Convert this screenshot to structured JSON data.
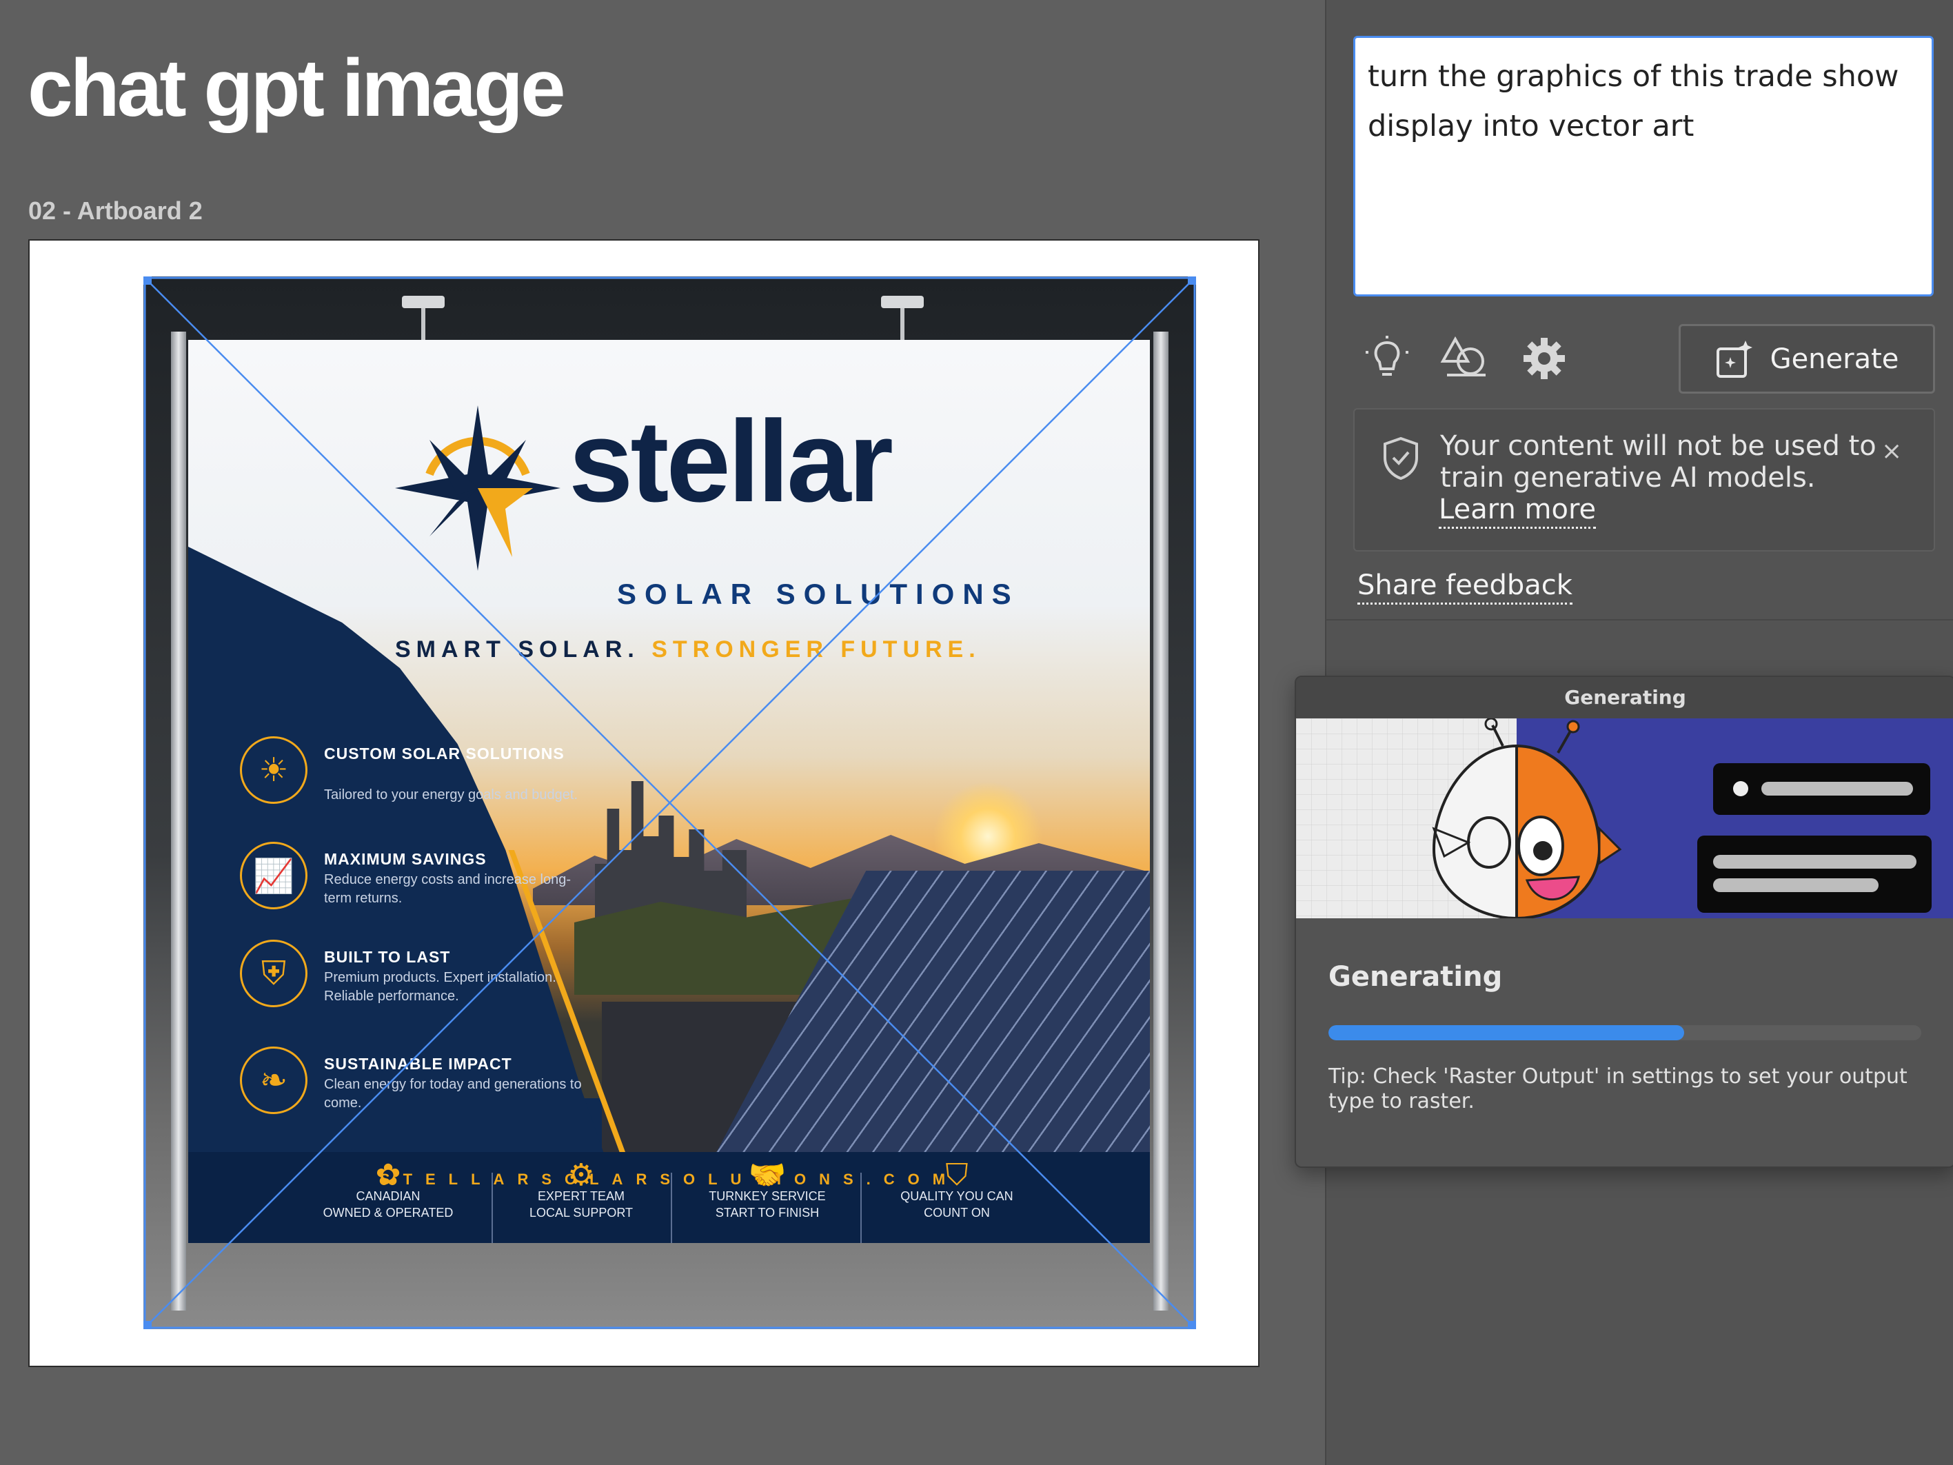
{
  "document": {
    "title": "chat gpt image",
    "artboard_label": "02 - Artboard 2"
  },
  "booth_graphic": {
    "brand_name": "stellar",
    "brand_subtitle": "SOLAR SOLUTIONS",
    "tagline_part1": "SMART SOLAR.",
    "tagline_part2": "STRONGER FUTURE.",
    "features": [
      {
        "title": "CUSTOM SOLAR SOLUTIONS",
        "desc": "Tailored to your energy goals and budget.",
        "icon": "sun-icon"
      },
      {
        "title": "MAXIMUM SAVINGS",
        "desc": "Reduce energy costs and increase long-term returns.",
        "icon": "chart-icon"
      },
      {
        "title": "BUILT TO LAST",
        "desc": "Premium products. Expert installation. Reliable performance.",
        "icon": "shield-icon"
      },
      {
        "title": "SUSTAINABLE IMPACT",
        "desc": "Clean energy for today and generations to come.",
        "icon": "leaf-icon"
      }
    ],
    "footer_items": [
      {
        "line1": "CANADIAN",
        "line2": "OWNED & OPERATED",
        "icon": "maple-leaf-icon"
      },
      {
        "line1": "EXPERT TEAM",
        "line2": "LOCAL SUPPORT",
        "icon": "gear-icon"
      },
      {
        "line1": "TURNKEY SERVICE",
        "line2": "START TO FINISH",
        "icon": "handshake-icon"
      },
      {
        "line1": "QUALITY YOU CAN",
        "line2": "COUNT ON",
        "icon": "check-shield-icon"
      }
    ],
    "website": "STELLARSOLARSOLUTIONS.COM",
    "colors": {
      "navy": "#0f2a52",
      "gold": "#f2a91b"
    }
  },
  "panel": {
    "prompt_text": "turn the graphics of this trade show display into vector art",
    "tools": [
      "lightbulb-icon",
      "shape-style-icon",
      "gear-icon"
    ],
    "generate_label": "Generate",
    "notice_text": "Your content will not be used to train generative AI models.",
    "learn_more": "Learn more",
    "notice_close": "×",
    "share_feedback": "Share feedback"
  },
  "generating_dialog": {
    "header": "Generating",
    "title": "Generating",
    "progress": 0.6,
    "tip": "Tip: Check 'Raster Output' in settings to set your output type to raster."
  },
  "colors": {
    "selection": "#4a8cf0",
    "progress": "#3b8beb"
  }
}
